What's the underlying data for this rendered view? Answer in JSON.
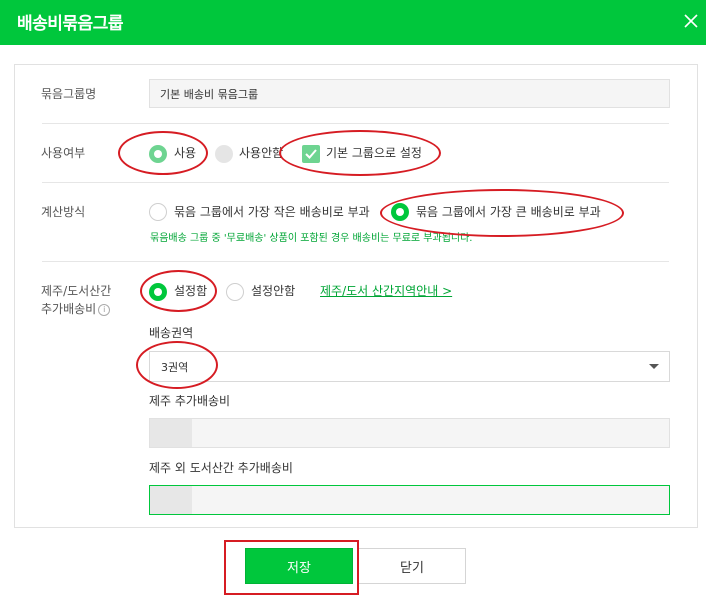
{
  "dialog": {
    "title": "배송비묶음그룹",
    "close_icon": "close-icon"
  },
  "group_name": {
    "label": "묶음그룹명",
    "value": "기본 배송비 묶음그룹"
  },
  "usage": {
    "label": "사용여부",
    "options": [
      "사용",
      "사용안함"
    ],
    "selected": "사용",
    "default_group_label": "기본 그룹으로 설정",
    "default_group_checked": true
  },
  "calc_method": {
    "label": "계산방식",
    "options": [
      "묶음 그룹에서 가장 작은 배송비로 부과",
      "묶음 그룹에서 가장 큰 배송비로 부과"
    ],
    "selected": "묶음 그룹에서 가장 큰 배송비로 부과",
    "help": "묶음배송 그룹 중 '무료배송' 상품이 포함된 경우 배송비는 무료로 부과됩니다."
  },
  "island_fee": {
    "label_line1": "제주/도서산간",
    "label_line2": "추가배송비",
    "info_icon": "info-icon",
    "options": [
      "설정함",
      "설정안함"
    ],
    "selected": "설정함",
    "link_text": "제주/도서 산간지역안내 >",
    "zone_label": "배송권역",
    "zone_value": "3권역",
    "jeju_label": "제주 추가배송비",
    "other_label": "제주 외 도서산간 추가배송비"
  },
  "buttons": {
    "save": "저장",
    "close": "닫기"
  },
  "colors": {
    "brand_green": "#00c73c",
    "annotation_red": "#d61c23"
  }
}
